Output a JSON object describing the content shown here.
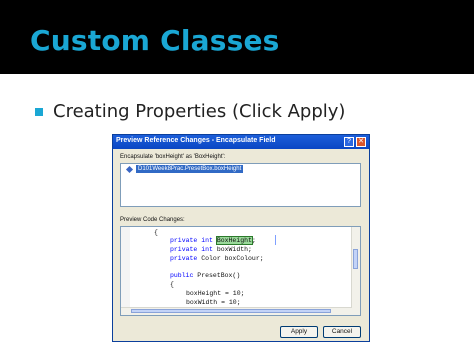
{
  "slide": {
    "title": "Custom Classes",
    "bullet": "Creating Properties (Click Apply)"
  },
  "dialog": {
    "title": "Preview Reference Changes - Encapsulate Field",
    "help_glyph": "?",
    "close_glyph": "✕",
    "encapsulate_label": "Encapsulate 'boxHeight' as 'BoxHeight':",
    "tree_item": "D101Week8Prac.PresetBox.boxHeight",
    "preview_label": "Preview Code Changes:",
    "code": {
      "l1": "{",
      "l2_kw": "private int",
      "l2_id": "BoxHeight",
      "l2_end": ";",
      "l3_kw": "private int",
      "l3_rest": " boxWidth;",
      "l4_kw": "private",
      "l4_rest": " Color boxColour;",
      "l6_kw": "public",
      "l6_rest": " PresetBox()",
      "l7": "{",
      "l8": "boxHeight = 10;",
      "l9": "boxWidth = 10;"
    },
    "apply_label": "Apply",
    "cancel_label": "Cancel"
  },
  "colors": {
    "title_accent": "#1aa7d4",
    "dialog_titlebar": "#0a46c4",
    "selection": "#316ac5",
    "highlight": "#9ad99a"
  }
}
